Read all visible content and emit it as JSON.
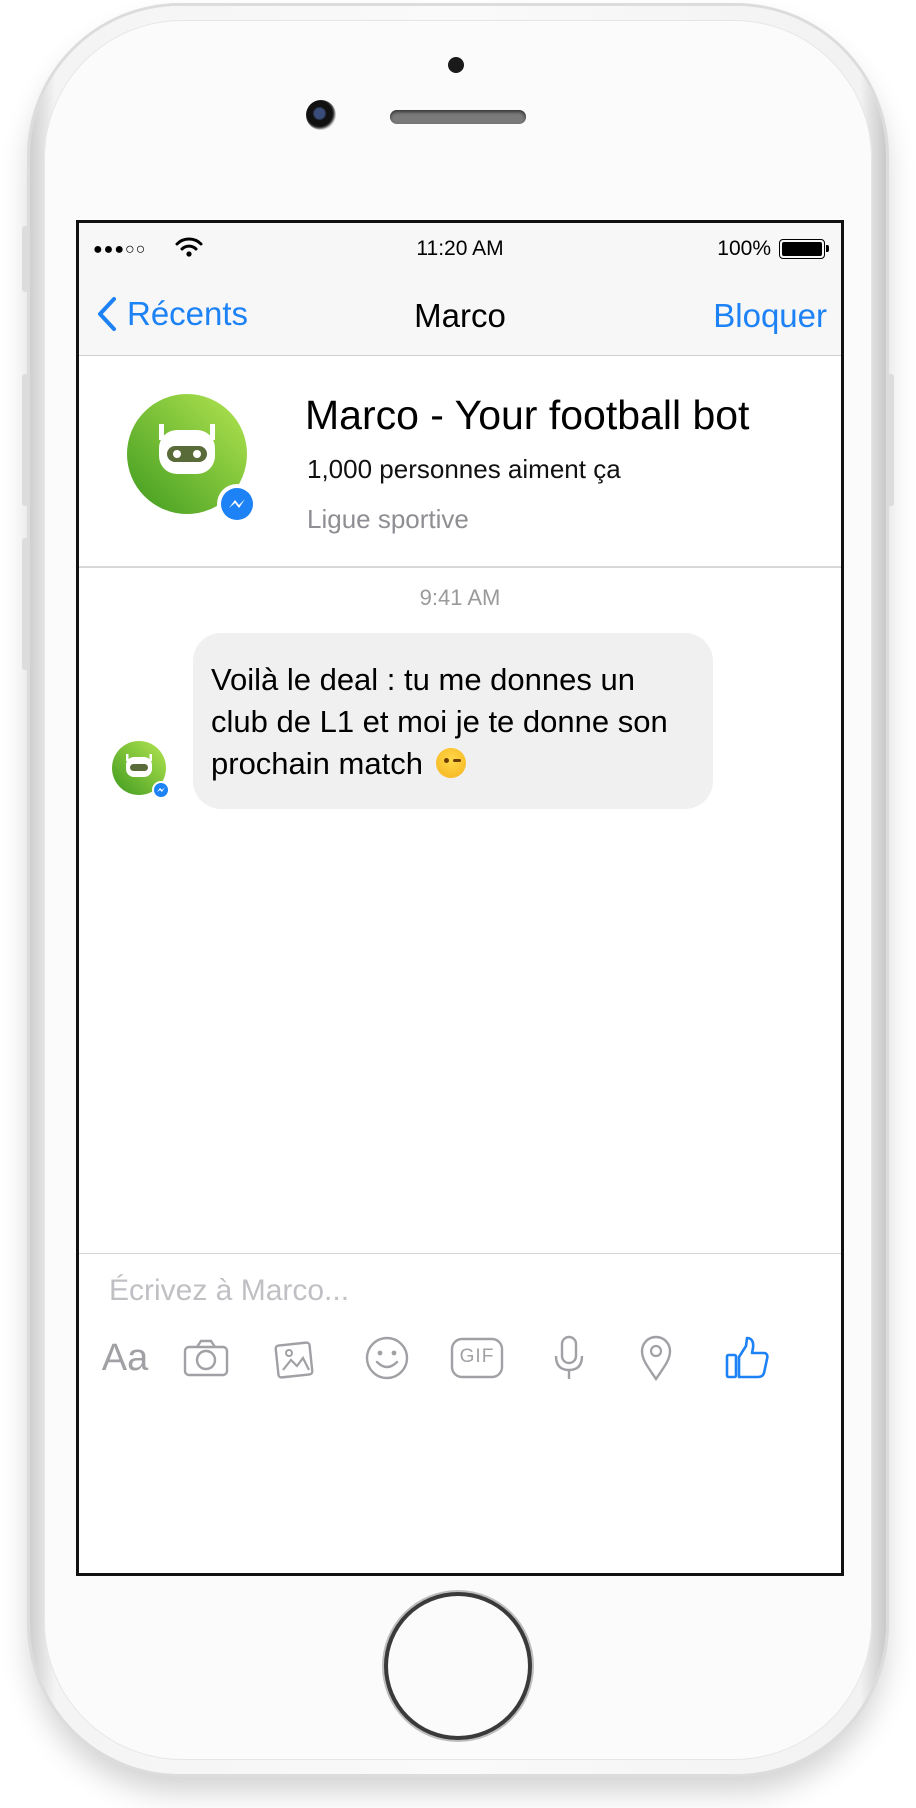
{
  "status_bar": {
    "signal": "●●●○○",
    "time": "11:20 AM",
    "battery": "100%"
  },
  "nav": {
    "back_label": "Récents",
    "title": "Marco",
    "right_label": "Bloquer"
  },
  "profile": {
    "name": "Marco - Your football bot",
    "likes": "1,000 personnes aiment ça",
    "category": "Ligue sportive"
  },
  "conversation": {
    "timestamp": "9:41 AM",
    "messages": [
      {
        "from": "bot",
        "text": "Voilà le deal : tu me donnes un club de L1 et moi je te donne son prochain match",
        "emoji": "winking-face"
      }
    ]
  },
  "composer": {
    "placeholder": "Écrivez à Marco...",
    "tools": [
      {
        "name": "text-format",
        "label": "Aa"
      },
      {
        "name": "camera-icon"
      },
      {
        "name": "gallery-icon"
      },
      {
        "name": "emoji-icon"
      },
      {
        "name": "gif-icon",
        "label": "GIF"
      },
      {
        "name": "microphone-icon"
      },
      {
        "name": "location-icon"
      },
      {
        "name": "like-icon"
      }
    ]
  },
  "colors": {
    "accent": "#1d82f5",
    "bot_green_light": "#a8e04a",
    "bot_green_dark": "#3f9a1f",
    "bubble_bg": "#f0f0f0",
    "muted": "#8e8e93"
  }
}
